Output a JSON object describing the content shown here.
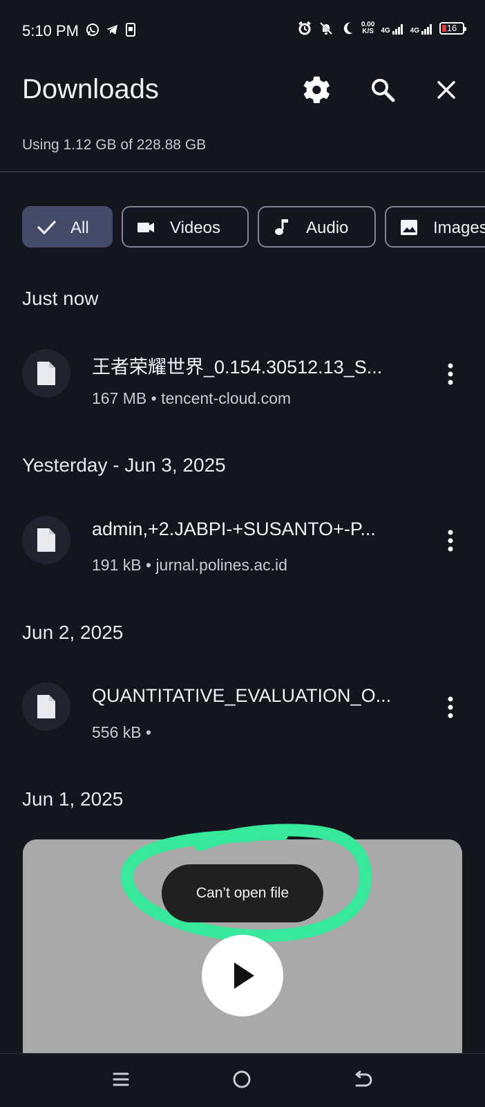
{
  "status_bar": {
    "time": "5:10 PM",
    "net_speed_value": "0.00",
    "net_speed_unit": "K/S",
    "signal_1": "4G",
    "signal_2": "4G",
    "battery_level": "16"
  },
  "header": {
    "title": "Downloads",
    "storage_text": "Using 1.12 GB of 228.88 GB",
    "icons": [
      "settings-icon",
      "search-icon",
      "close-icon"
    ]
  },
  "filters": [
    {
      "label": "All",
      "active": true,
      "icon": "check-icon"
    },
    {
      "label": "Videos",
      "active": false,
      "icon": "video-icon"
    },
    {
      "label": "Audio",
      "active": false,
      "icon": "music-icon"
    },
    {
      "label": "Images",
      "active": false,
      "icon": "image-icon"
    }
  ],
  "sections": [
    {
      "title": "Just now",
      "items": [
        {
          "name": "王者荣耀世界_0.154.30512.13_S...",
          "meta": "167 MB • tencent-cloud.com"
        }
      ]
    },
    {
      "title": "Yesterday - Jun 3, 2025",
      "items": [
        {
          "name": "admin,+2.JABPI-+SUSANTO+-P...",
          "meta": "191 kB • jurnal.polines.ac.id"
        }
      ]
    },
    {
      "title": "Jun 2, 2025",
      "items": [
        {
          "name": "QUANTITATIVE_EVALUATION_O...",
          "meta": "556 kB •"
        }
      ]
    },
    {
      "title": "Jun 1, 2025",
      "items": []
    }
  ],
  "toast": {
    "text": "Can’t open file"
  },
  "nav": {
    "icons": [
      "menu-icon",
      "home-icon",
      "back-icon"
    ]
  },
  "colors": {
    "background": "#13161e",
    "active_chip": "#434b68",
    "annotation": "#39e99b",
    "video_card": "#a9a9a9"
  }
}
